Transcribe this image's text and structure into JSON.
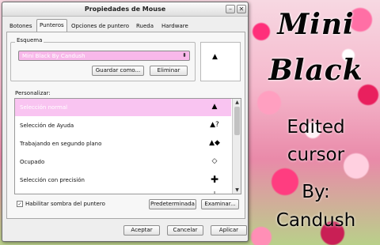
{
  "window": {
    "title": "Propiedades de Mouse",
    "minimize_glyph": "–",
    "close_glyph": "✕"
  },
  "tabs": [
    "Botones",
    "Punteros",
    "Opciones de puntero",
    "Rueda",
    "Hardware"
  ],
  "active_tab": "Punteros",
  "scheme": {
    "group_label": "Esquema",
    "selected_value": "Mini Black By Candush",
    "save_label": "Guardar como...",
    "delete_label": "Eliminar"
  },
  "customize": {
    "label": "Personalizar:",
    "rows": [
      {
        "label": "Selección normal",
        "selected": true,
        "cursor_icon": "arrow-cursor-icon",
        "glyph": "▲"
      },
      {
        "label": "Selección de Ayuda",
        "selected": false,
        "cursor_icon": "help-cursor-icon",
        "glyph": "▲?"
      },
      {
        "label": "Trabajando en segundo plano",
        "selected": false,
        "cursor_icon": "busy-arrow-cursor-icon",
        "glyph": "▲◆"
      },
      {
        "label": "Ocupado",
        "selected": false,
        "cursor_icon": "busy-cursor-icon",
        "glyph": "◇"
      },
      {
        "label": "Selección con precisión",
        "selected": false,
        "cursor_icon": "crosshair-cursor-icon",
        "glyph": "✚"
      },
      {
        "label": "",
        "selected": false,
        "cursor_icon": "text-cursor-icon",
        "glyph": "I"
      }
    ]
  },
  "shadow": {
    "label": "Habilitar sombra del puntero",
    "checked": true,
    "check_glyph": "✓"
  },
  "buttons": {
    "default_label": "Predeterminada",
    "browse_label": "Examinar...",
    "ok_label": "Aceptar",
    "cancel_label": "Cancelar",
    "apply_label": "Aplicar"
  },
  "wallpaper": {
    "line1": "Mini",
    "line2": "Black",
    "line3": "Edited",
    "line4": "cursor",
    "line5": "By:",
    "line6": "Candush"
  },
  "colors": {
    "selection": "#f9c4f1",
    "combo": "#f8b8ea"
  }
}
